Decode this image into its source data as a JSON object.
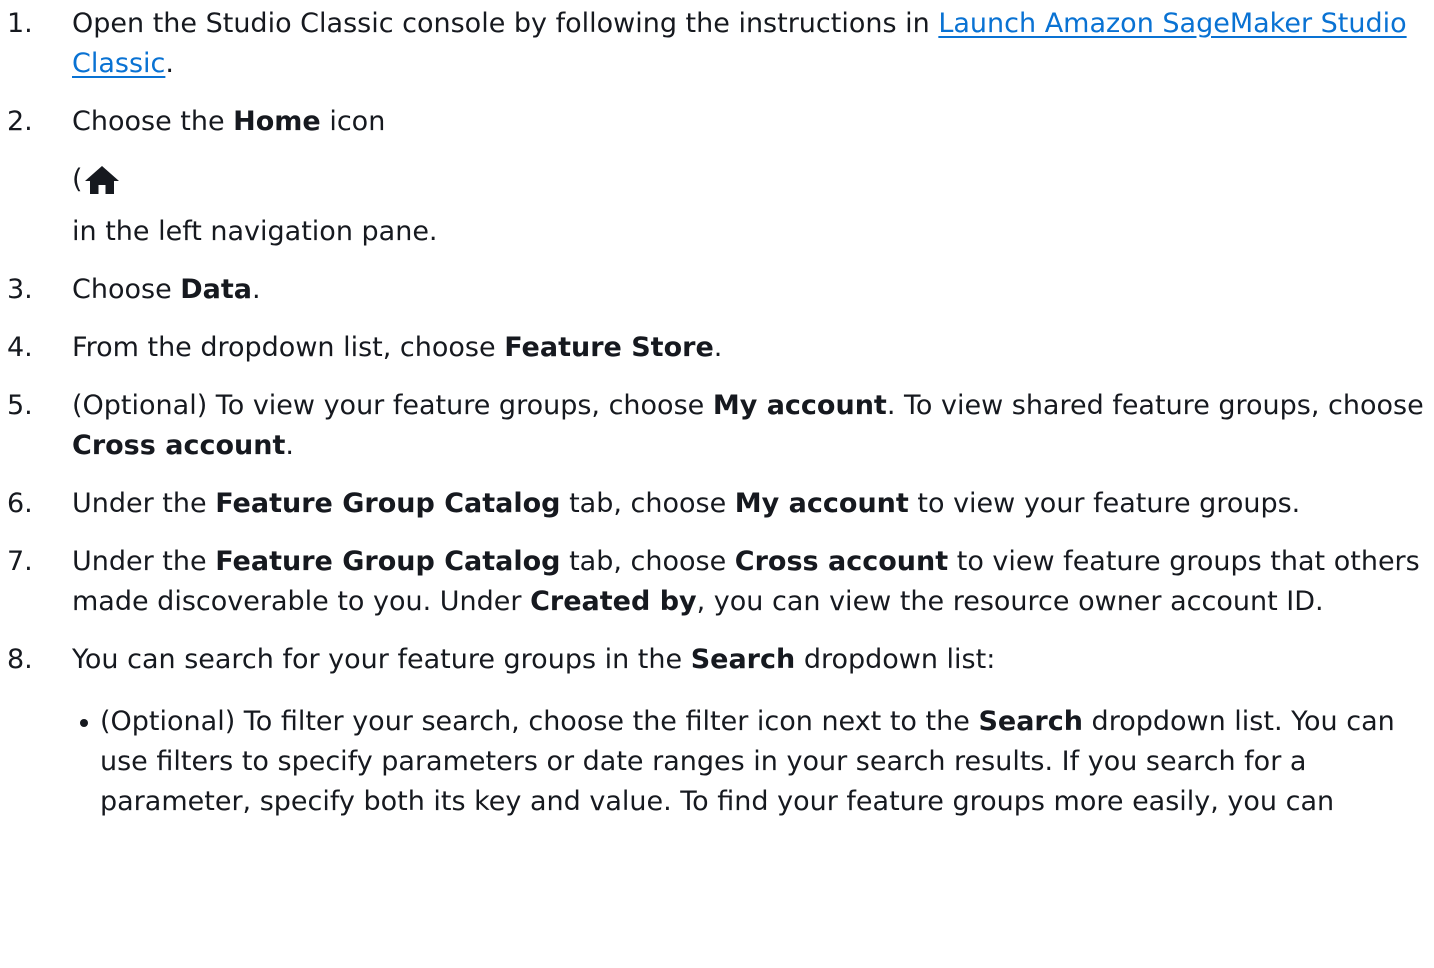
{
  "steps": [
    {
      "number": "1.",
      "text_before": "Open the Studio Classic console by following the instructions in ",
      "link": "Launch Amazon SageMaker Studio Classic",
      "text_after": "."
    },
    {
      "number": "2.",
      "text_before": "Choose the ",
      "bold": "Home",
      "text_after": " icon",
      "paren_open": "(",
      "icon": "home-icon",
      "continuation": "in the left navigation pane."
    },
    {
      "number": "3.",
      "text_before": "Choose ",
      "bold": "Data",
      "text_after": "."
    },
    {
      "number": "4.",
      "text_before": "From the dropdown list, choose ",
      "bold": "Feature Store",
      "text_after": "."
    },
    {
      "number": "5.",
      "text_before": "(Optional) To view your feature groups, choose ",
      "bold1": "My account",
      "text_mid": ". To view shared feature groups, choose ",
      "bold2": "Cross account",
      "text_after": "."
    },
    {
      "number": "6.",
      "text_before": "Under the ",
      "bold1": "Feature Group Catalog",
      "text_mid": " tab, choose ",
      "bold2": "My account",
      "text_after": " to view your feature groups."
    },
    {
      "number": "7.",
      "text_before": "Under the ",
      "bold1": "Feature Group Catalog",
      "text_mid1": " tab, choose ",
      "bold2": "Cross account",
      "text_mid2": " to view feature groups that others made discoverable to you. Under ",
      "bold3": "Created by",
      "text_after": ", you can view the resource owner account ID."
    },
    {
      "number": "8.",
      "text_before": "You can search for your feature groups in the ",
      "bold": "Search",
      "text_after": " dropdown list:",
      "sub_items": [
        {
          "text_before": "(Optional) To filter your search, choose the filter icon next to the ",
          "bold": "Search",
          "text_after": " dropdown list. You can use filters to specify parameters or date ranges in your search results. If you search for a parameter, specify both its key and value. To find your feature groups more easily, you can"
        }
      ]
    }
  ],
  "colors": {
    "text": "#16191f",
    "link": "#0972d3"
  }
}
